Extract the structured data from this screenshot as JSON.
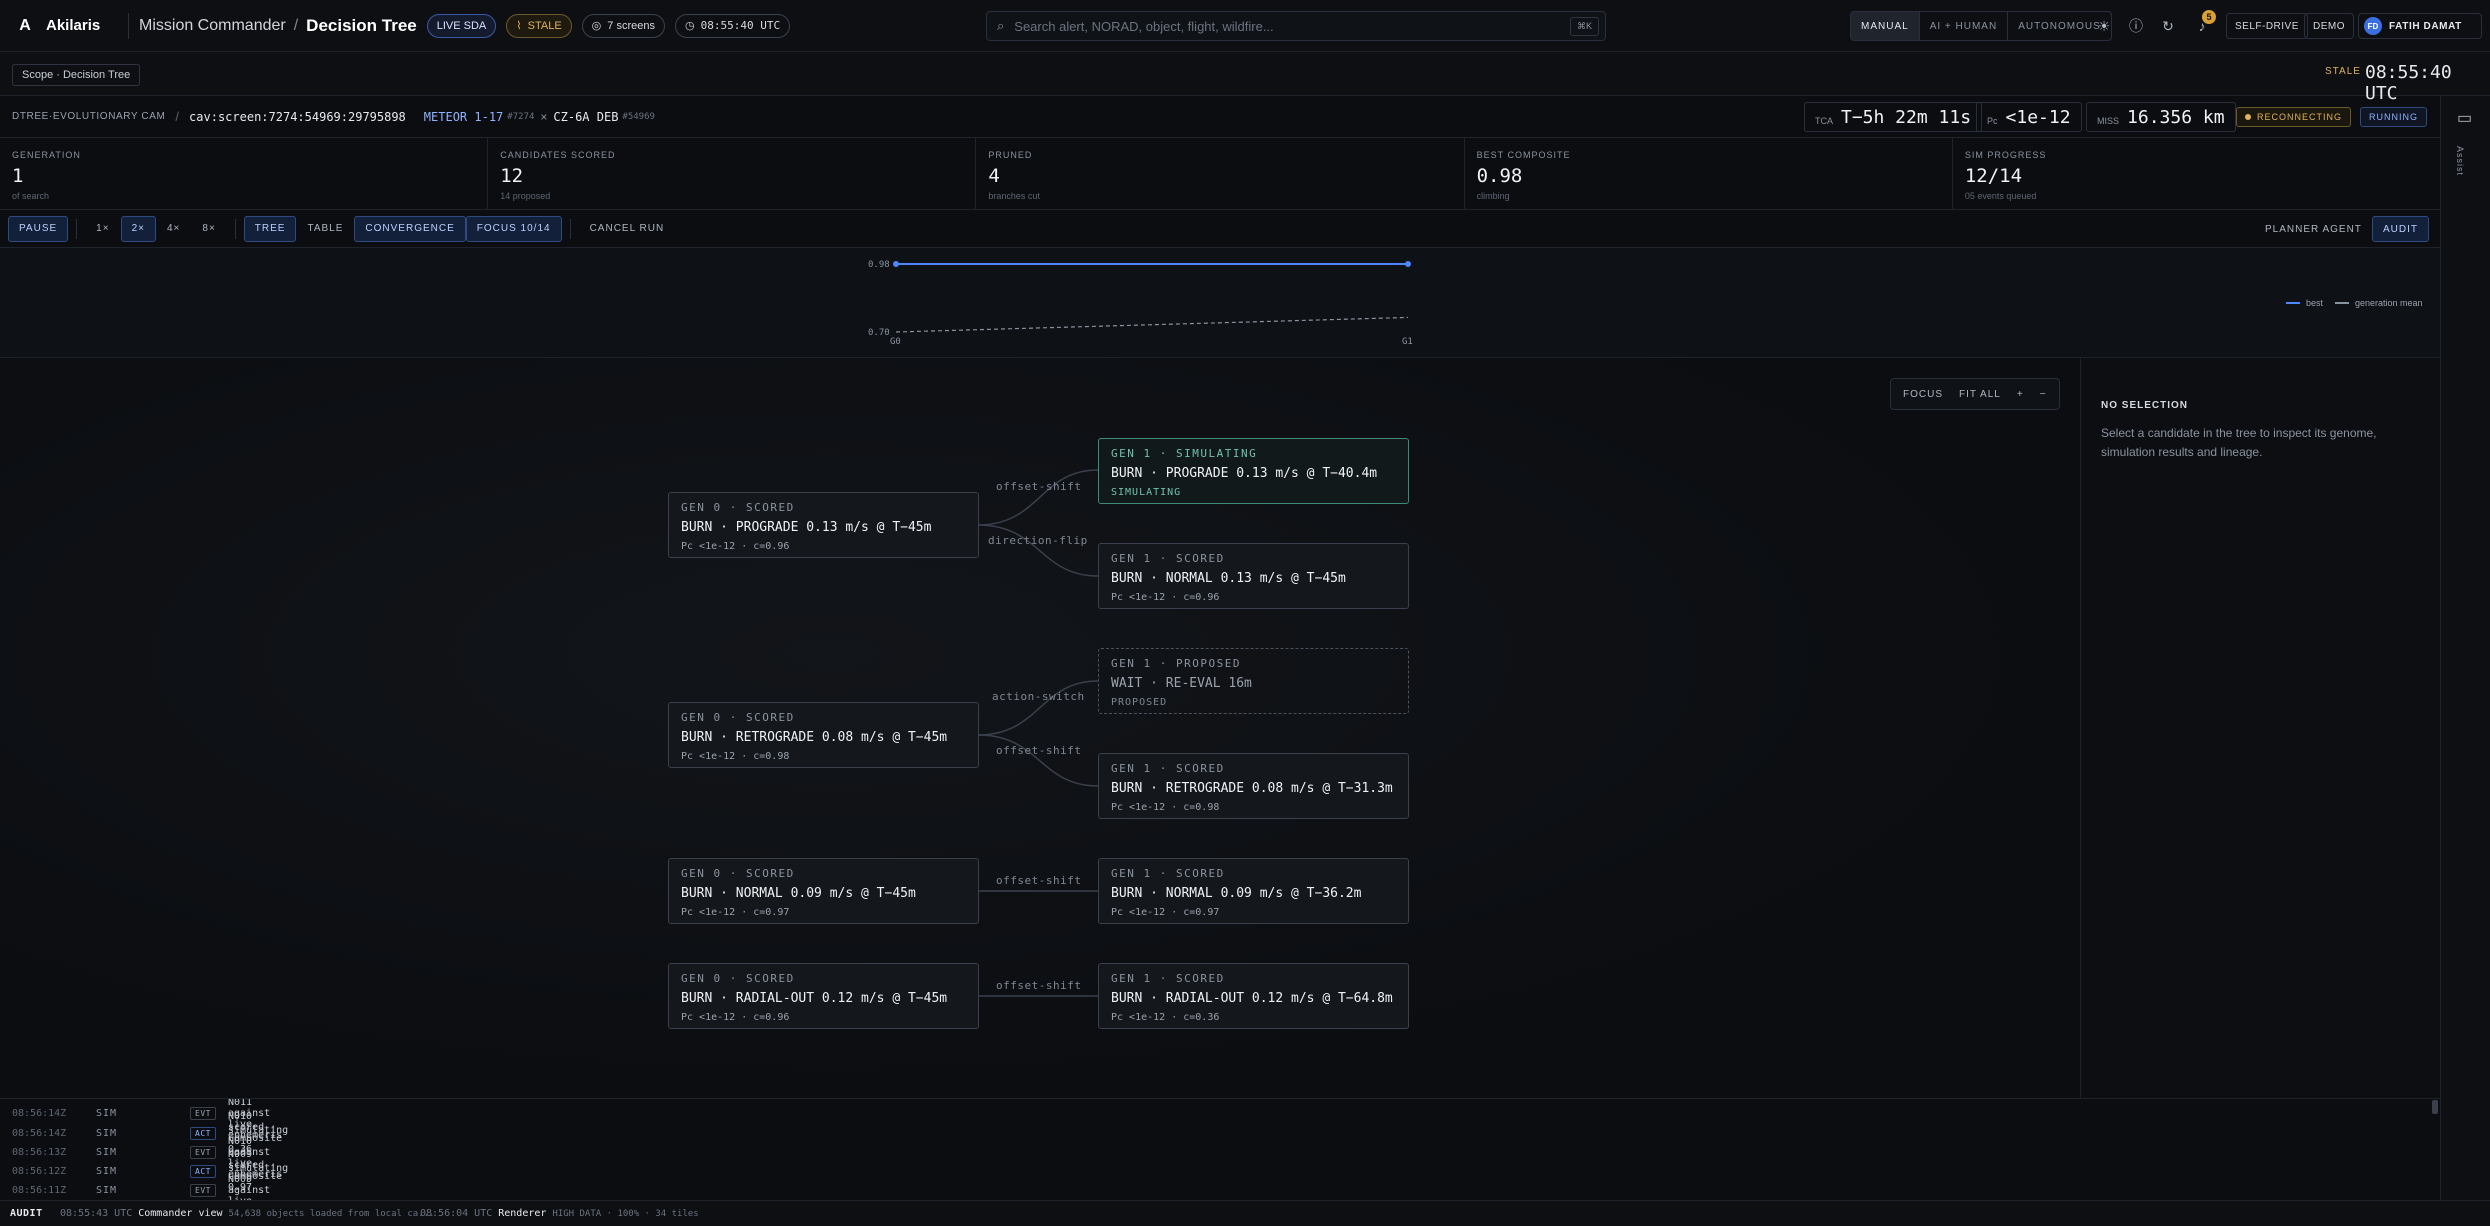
{
  "app": {
    "name": "Akilaris"
  },
  "breadcrumb": {
    "parent": "Mission Commander",
    "current": "Decision Tree"
  },
  "badges": {
    "live": "LIVE SDA",
    "stale": "STALE",
    "screens": "7 screens",
    "clock": "08:55:40 UTC"
  },
  "search": {
    "placeholder": "Search alert, NORAD, object, flight, wildfire...",
    "shortcut": "⌘K"
  },
  "modes": [
    {
      "label": "MANUAL",
      "active": true
    },
    {
      "label": "AI + HUMAN",
      "active": false
    },
    {
      "label": "AUTONOMOUS",
      "active": false
    }
  ],
  "toolbar": {
    "notifications": "5",
    "self_drive": "SELF-DRIVE",
    "demo": "DEMO"
  },
  "user": {
    "initials": "FD",
    "name": "FATIH DAMAT"
  },
  "scope": {
    "chip": "Scope · Decision Tree",
    "stale_label": "STALE",
    "stale_time": "08:55:40 UTC"
  },
  "mission": {
    "tag": "DTREE·EVOLUTIONARY CAM",
    "id": "cav:screen:7274:54969:29795898",
    "satellite": "METEOR 1-17",
    "sat_norad": "#7274",
    "x": "×",
    "debris": "CZ-6A DEB",
    "deb_norad": "#54969",
    "tca_label": "TCA",
    "tca": "T−5h 22m 11s",
    "pc_label": "Pc",
    "pc": "<1e-12",
    "miss_label": "MISS",
    "miss": "16.356 km",
    "reconnecting": "RECONNECTING",
    "running": "RUNNING"
  },
  "metrics": [
    {
      "label": "GENERATION",
      "value": "1",
      "sub": "of search"
    },
    {
      "label": "CANDIDATES SCORED",
      "value": "12",
      "sub": "14 proposed"
    },
    {
      "label": "PRUNED",
      "value": "4",
      "sub": "branches cut"
    },
    {
      "label": "BEST COMPOSITE",
      "value": "0.98",
      "sub": "climbing"
    },
    {
      "label": "SIM PROGRESS",
      "value": "12/14",
      "sub": "05 events queued"
    }
  ],
  "controls": {
    "pause": "PAUSE",
    "speeds": [
      {
        "label": "1×",
        "on": false
      },
      {
        "label": "2×",
        "on": true
      },
      {
        "label": "4×",
        "on": false
      },
      {
        "label": "8×",
        "on": false
      }
    ],
    "tree": "TREE",
    "table": "TABLE",
    "convergence": "CONVERGENCE",
    "focus": "FOCUS 10/14",
    "cancel": "CANCEL RUN",
    "planner": "PLANNER AGENT",
    "audit": "AUDIT"
  },
  "chart_data": {
    "type": "line",
    "x": [
      "G0",
      "G1"
    ],
    "series": [
      {
        "name": "best",
        "values": [
          0.98,
          0.98
        ],
        "color": "#4d86ff"
      },
      {
        "name": "generation mean",
        "values": [
          0.7,
          0.76
        ],
        "color": "#8a93a0"
      }
    ],
    "ylim": [
      0.7,
      0.98
    ],
    "ytick_labels": [
      "0.98",
      "0.70"
    ],
    "xtick_labels": [
      "G0",
      "G1"
    ],
    "legend_position": "right",
    "grid": false
  },
  "canvas_tools": {
    "focus": "FOCUS",
    "fit": "FIT ALL",
    "zoom_in": "+",
    "zoom_out": "−"
  },
  "tree": {
    "nodes": [
      {
        "gen": "GEN 0 · SCORED",
        "title": "BURN · PROGRADE 0.13 m/s @ T−45m",
        "sub": "Pc <1e-12 · c=0.96",
        "state": "scored"
      },
      {
        "gen": "GEN 1 · SIMULATING",
        "title": "BURN · PROGRADE 0.13 m/s @ T−40.4m",
        "sub": "SIMULATING",
        "state": "sim"
      },
      {
        "gen": "GEN 1 · SCORED",
        "title": "BURN · NORMAL 0.13 m/s @ T−45m",
        "sub": "Pc <1e-12 · c=0.96",
        "state": "scored"
      },
      {
        "gen": "GEN 0 · SCORED",
        "title": "BURN · RETROGRADE 0.08 m/s @ T−45m",
        "sub": "Pc <1e-12 · c=0.98",
        "state": "scored"
      },
      {
        "gen": "GEN 1 · PROPOSED",
        "title": "WAIT · RE-EVAL 16m",
        "sub": "PROPOSED",
        "state": "proposed"
      },
      {
        "gen": "GEN 1 · SCORED",
        "title": "BURN · RETROGRADE 0.08 m/s @ T−31.3m",
        "sub": "Pc <1e-12 · c=0.98",
        "state": "scored"
      },
      {
        "gen": "GEN 0 · SCORED",
        "title": "BURN · NORMAL 0.09 m/s @ T−45m",
        "sub": "Pc <1e-12 · c=0.97",
        "state": "scored"
      },
      {
        "gen": "GEN 1 · SCORED",
        "title": "BURN · NORMAL 0.09 m/s @ T−36.2m",
        "sub": "Pc <1e-12 · c=0.97",
        "state": "scored"
      },
      {
        "gen": "GEN 0 · SCORED",
        "title": "BURN · RADIAL-OUT 0.12 m/s @ T−45m",
        "sub": "Pc <1e-12 · c=0.96",
        "state": "scored"
      },
      {
        "gen": "GEN 1 · SCORED",
        "title": "BURN · RADIAL-OUT 0.12 m/s @ T−64.8m",
        "sub": "Pc <1e-12 · c=0.36",
        "state": "scored"
      }
    ],
    "edges": [
      {
        "label": "offset-shift"
      },
      {
        "label": "direction-flip"
      },
      {
        "label": "action-switch"
      },
      {
        "label": "offset-shift"
      },
      {
        "label": "offset-shift"
      },
      {
        "label": "offset-shift"
      }
    ]
  },
  "panel": {
    "title": "NO SELECTION",
    "text": "Select a candidate in the tree to inspect its genome, simulation results and lineage."
  },
  "rail": {
    "label": "Assist"
  },
  "log": [
    {
      "time": "08:56:14Z",
      "src": "SIM",
      "kind": "EVT",
      "msg": "simulating N011 against live ephemeris"
    },
    {
      "time": "08:56:14Z",
      "src": "SIM",
      "kind": "ACT",
      "msg": "N010 scored · composite 0.36"
    },
    {
      "time": "08:56:13Z",
      "src": "SIM",
      "kind": "EVT",
      "msg": "simulating N010 against live ephemeris"
    },
    {
      "time": "08:56:12Z",
      "src": "SIM",
      "kind": "ACT",
      "msg": "N009 scored · composite 0.97"
    },
    {
      "time": "08:56:11Z",
      "src": "SIM",
      "kind": "EVT",
      "msg": "simulating N009 against live ephemeris"
    }
  ],
  "footer": {
    "audit": "AUDIT",
    "e1_time": "08:55:43 UTC",
    "e1_name": "Commander view",
    "e1_detail": "54,638 objects loaded from local ca...",
    "e2_time": "08:56:04 UTC",
    "e2_name": "Renderer",
    "e2_detail": "HIGH DATA · 100% · 34 tiles"
  }
}
